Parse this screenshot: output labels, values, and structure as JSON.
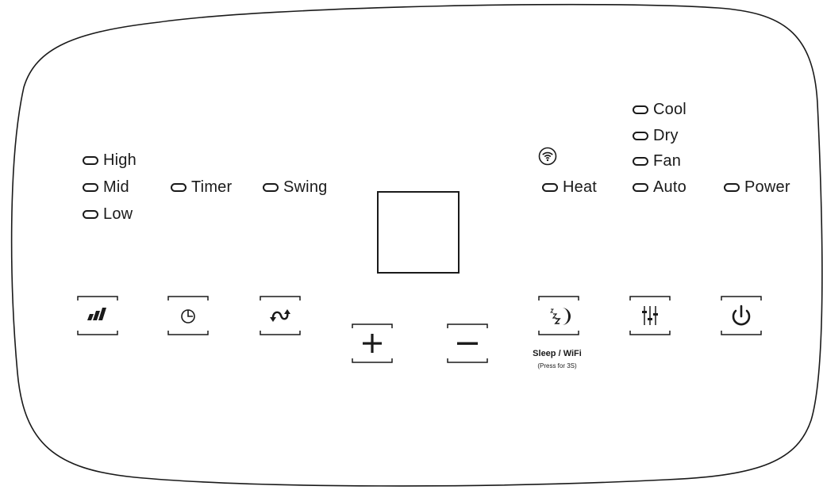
{
  "fan_speed": {
    "high": "High",
    "mid": "Mid",
    "low": "Low"
  },
  "timer_label": "Timer",
  "swing_label": "Swing",
  "heat_label": "Heat",
  "modes": {
    "cool": "Cool",
    "dry": "Dry",
    "fan": "Fan",
    "auto": "Auto"
  },
  "power_label": "Power",
  "sleep_wifi": {
    "label": "Sleep / WiFi",
    "note": "(Press for 3S)"
  },
  "icons": {
    "fan_speed_button": "fan-speed-bars-icon",
    "timer_button": "clock-icon",
    "swing_button": "swing-arrows-icon",
    "plus_button": "plus-icon",
    "minus_button": "minus-icon",
    "sleep_button": "moon-zz-icon",
    "mode_button": "sliders-icon",
    "power_button": "power-icon",
    "wifi_indicator": "wifi-icon"
  },
  "colors": {
    "outline": "#1a1a1a",
    "background": "#ffffff"
  }
}
